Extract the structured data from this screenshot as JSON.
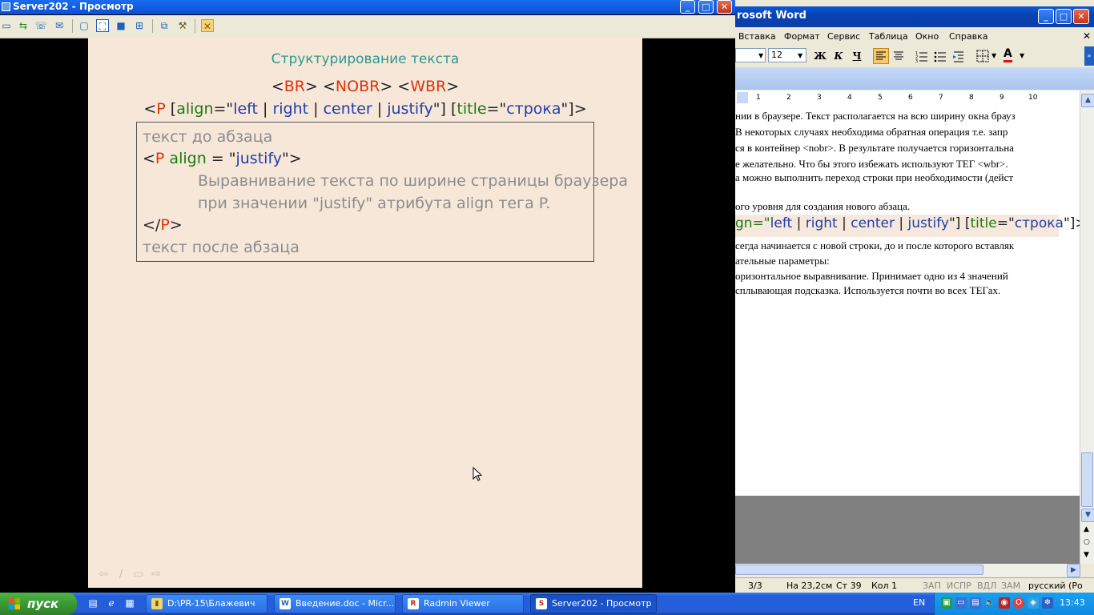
{
  "word": {
    "title": "rosoft Word",
    "menu": [
      "Вставка",
      "Формат",
      "Сервис",
      "Таблица",
      "Окно",
      "Справка"
    ],
    "font_size": "12",
    "bold_label": "Ж",
    "italic_label": "К",
    "underline_label": "Ч",
    "ruler_ticks": [
      "1",
      "2",
      "3",
      "4",
      "5",
      "6",
      "7",
      "8",
      "9",
      "10"
    ],
    "lines": [
      "нии в браузере. Текст располагается на всю ширину окна брауз",
      "  В некоторых случаях необходима обратная операция т.е. запр",
      "ся в контейнер <nobr>. В результате получается горизонтальна",
      "е желательно. Что бы этого избежать используют ТЕГ <wbr>. ",
      "а можно выполнить переход строки при необходимости (дейст",
      "",
      "ого уровня для создания нового абзаца.",
      "",
      "",
      "сегда начинается с новой строки, до и после которого вставляк",
      "ательные параметры:",
      "оризонтальное выравнивание. Принимает одно из 4 значений",
      "сплывающая подсказка. Используется почти во всех ТЕГах."
    ],
    "highlight": {
      "p1": "gn=\"",
      "left": "left",
      "sep": " | ",
      "right": "right",
      "center": "center",
      "justify": "justify",
      "p2": "\"] [",
      "title_attr": "title",
      "eq": "=\"",
      "stroka": "строка",
      "p3": "\"]>"
    },
    "status": {
      "pages": "3/3",
      "position": "На 23,2см",
      "line": "Ст 39",
      "col": "Кол 1",
      "rec": "ЗАП",
      "trk": "ИСПР",
      "ext": "ВДЛ",
      "ovr": "ЗАМ",
      "lang": "русский (Ро"
    }
  },
  "radmin": {
    "title": "Server202 - Просмотр",
    "slide": {
      "title": "Структурирование текста",
      "tags": {
        "lt": "<",
        "gt": ">",
        "br": "BR",
        "nobr": "NOBR",
        "wbr": "WBR"
      },
      "syntax": {
        "open": "<",
        "p": "P",
        "b1": " [",
        "align": "align",
        "eq": "=\"",
        "left": "left",
        "sep": " | ",
        "right": "right",
        "center": "center",
        "justify": "justify",
        "b2": "\"] [",
        "title_attr": "title",
        "stroka": "строка",
        "end": "\"]>"
      },
      "example": {
        "before": "текст до абзаца",
        "open_lt": "<",
        "p": "P",
        "align": " align",
        "eq": " = \"",
        "justify": "justify",
        "open_end": "\">",
        "body1": "Выравнивание текста по ширине страницы браузера",
        "body2": "при значении \"justify\" атрибута align тега P.",
        "close_lt": "</",
        "close_gt": ">",
        "after": "текст после абзаца"
      },
      "nav": [
        "⇦",
        "∕",
        "▭",
        "⇨"
      ]
    }
  },
  "taskbar": {
    "start_label": "пуск",
    "tasks": [
      {
        "icon": "▮",
        "label": "D:\\PR-15\\Блажевич"
      },
      {
        "icon": "W",
        "label": "Введение.doc - Micr..."
      },
      {
        "icon": "R",
        "label": "Radmin Viewer"
      },
      {
        "icon": "S",
        "label": "Server202 - Просмотр"
      }
    ],
    "lang": "EN",
    "clock": "13:43"
  }
}
